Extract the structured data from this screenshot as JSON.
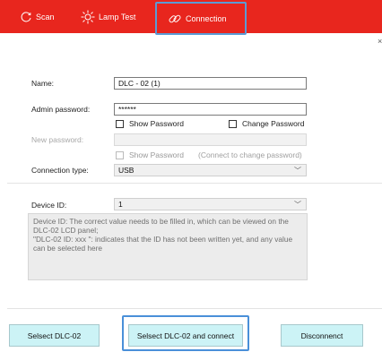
{
  "toolbar": {
    "tabs": [
      {
        "label": "Scan",
        "icon": "refresh-icon"
      },
      {
        "label": "Lamp Test",
        "icon": "sun-icon"
      },
      {
        "label": "Connection",
        "icon": "link-icon"
      }
    ],
    "active_tab": "Connection",
    "background": "#e8261e"
  },
  "form": {
    "name_label": "Name:",
    "name_value": "DLC - 02 (1)",
    "admin_password_label": "Admin password:",
    "admin_password_value": "******",
    "show_password_label": "Show Password",
    "change_password_label": "Change Password",
    "new_password_label": "New password:",
    "new_password_value": "",
    "show_password2_label": "Show Password",
    "connect_hint": "(Connect to change password)",
    "connection_type_label": "Connection type:",
    "connection_type_value": "USB",
    "device_id_label": "Device ID:",
    "device_id_value": "1"
  },
  "description": {
    "line1": "Device ID: The correct value needs to be filled in, which can be viewed on the DLC-02 LCD panel;",
    "line2": "\"DLC-02 ID: xxx \": indicates that the ID has not been written yet, and any value can be selected here"
  },
  "buttons": {
    "select": "Selsect DLC-02",
    "select_connect": "Selsect DLC-02 and connect",
    "disconnect": "Disconnenct"
  },
  "close_glyph": "×"
}
